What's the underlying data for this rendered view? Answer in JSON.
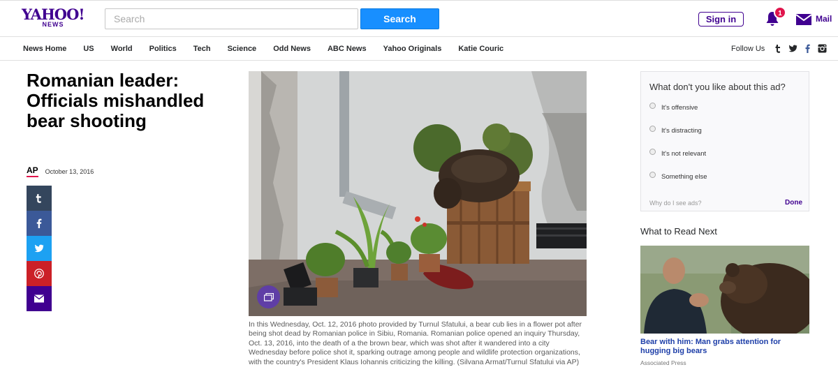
{
  "header": {
    "logo_brand": "YAHOO!",
    "logo_sub": "NEWS",
    "search_placeholder": "Search",
    "search_button": "Search",
    "signin": "Sign in",
    "notification_count": "1",
    "mail_label": "Mail"
  },
  "nav": {
    "items": [
      "News Home",
      "US",
      "World",
      "Politics",
      "Tech",
      "Science",
      "Odd News",
      "ABC News",
      "Yahoo Originals",
      "Katie Couric"
    ],
    "follow_label": "Follow Us",
    "follow_icons": [
      "tumblr-icon",
      "twitter-icon",
      "facebook-icon",
      "instagram-icon"
    ]
  },
  "article": {
    "headline": "Romanian leader: Officials mishandled bear shooting",
    "source": "AP",
    "date": "October 13, 2016",
    "share_buttons": [
      {
        "name": "tumblr",
        "color": "#34465d"
      },
      {
        "name": "facebook",
        "color": "#3b5998"
      },
      {
        "name": "twitter",
        "color": "#1da1f2"
      },
      {
        "name": "pinterest",
        "color": "#cb2027"
      },
      {
        "name": "email",
        "color": "#400090"
      }
    ],
    "caption": "In this Wednesday, Oct. 12, 2016 photo provided by Turnul Sfatului, a bear cub lies in a flower pot after being shot dead by Romanian police in Sibiu, Romania. Romanian police opened an inquiry Thursday, Oct. 13, 2016, into the death of a the brown bear, which was shot after it wandered into a city Wednesday before police shot it, sparking outrage among people and wildlife protection organizations, with the country's President Klaus Iohannis criticizing the killing. (Silvana Armat/Turnul Sfatului via AP)"
  },
  "ad_feedback": {
    "title": "What don't you like about this ad?",
    "options": [
      "It's offensive",
      "It's distracting",
      "It's not relevant",
      "Something else"
    ],
    "why_link": "Why do I see ads?",
    "done": "Done"
  },
  "read_next": {
    "title": "What to Read Next",
    "headline": "Bear with him: Man grabs attention for hugging big bears",
    "source": "Associated Press"
  },
  "colors": {
    "brand_purple": "#400090",
    "search_blue": "#188fff",
    "badge_red": "#e0144c",
    "link_blue": "#1d3ea8"
  }
}
